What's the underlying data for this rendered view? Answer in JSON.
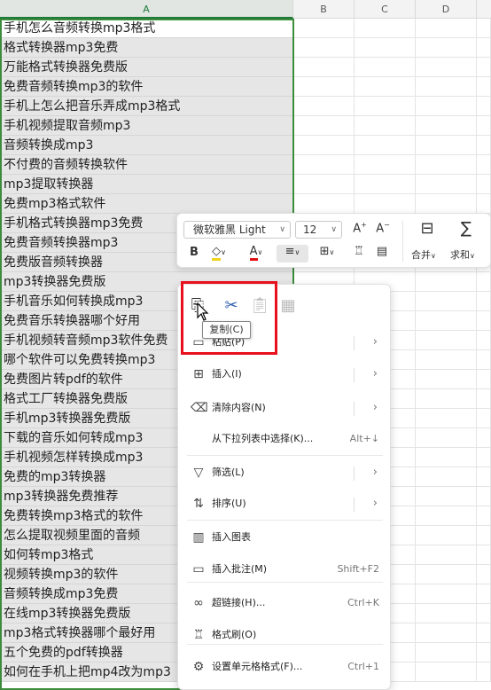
{
  "columns": [
    "A",
    "B",
    "C",
    "D"
  ],
  "rows": [
    "手机怎么音频转换mp3格式",
    "格式转换器mp3免费",
    "万能格式转换器免费版",
    "免费音频转换mp3的软件",
    "手机上怎么把音乐弄成mp3格式",
    "手机视频提取音频mp3",
    "音频转换成mp3",
    "不付费的音频转换软件",
    "mp3提取转换器",
    "免费mp3格式软件",
    "手机格式转换器mp3免费",
    "免费音频转换器mp3",
    "免费版音频转换器",
    "mp3转换器免费版",
    "手机音乐如何转换成mp3",
    "免费音乐转换器哪个好用",
    "手机视频转音频mp3软件免费",
    "哪个软件可以免费转换mp3",
    "免费图片转pdf的软件",
    "格式工厂转换器免费版",
    "手机mp3转换器免费版",
    "下载的音乐如何转成mp3",
    "手机视频怎样转换成mp3",
    "免费的mp3转换器",
    "mp3转换器免费推荐",
    "免费转换mp3格式的软件",
    "怎么提取视频里面的音频",
    "如何转mp3格式",
    "视频转换mp3的软件",
    "音频转换成mp3免费",
    "在线mp3转换器免费版",
    "mp3格式转换器哪个最好用",
    "五个免费的pdf转换器",
    "如何在手机上把mp4改为mp3"
  ],
  "toolbar": {
    "font_name": "微软雅黑 Light",
    "font_size": "12",
    "bold": "B",
    "merge_label": "合并",
    "sum_label": "求和"
  },
  "context_menu": {
    "tooltip": "复制(C)",
    "items": [
      {
        "label": "粘贴(P)",
        "icon": "paste-icon",
        "shortcut": "",
        "has_submenu": true
      },
      {
        "label": "插入(I)",
        "icon": "insert-icon",
        "shortcut": "",
        "has_submenu": true
      },
      {
        "label": "清除内容(N)",
        "icon": "clear-icon",
        "shortcut": "",
        "has_submenu": true
      },
      {
        "label": "从下拉列表中选择(K)...",
        "icon": "",
        "shortcut": "Alt+↓",
        "has_submenu": false
      },
      {
        "label": "筛选(L)",
        "icon": "filter-icon",
        "shortcut": "",
        "has_submenu": true
      },
      {
        "label": "排序(U)",
        "icon": "sort-icon",
        "shortcut": "",
        "has_submenu": true
      },
      {
        "label": "插入图表",
        "icon": "chart-icon",
        "shortcut": "",
        "has_submenu": false
      },
      {
        "label": "插入批注(M)",
        "icon": "comment-icon",
        "shortcut": "Shift+F2",
        "has_submenu": false
      },
      {
        "label": "超链接(H)...",
        "icon": "link-icon",
        "shortcut": "Ctrl+K",
        "has_submenu": false
      },
      {
        "label": "格式刷(O)",
        "icon": "format-painter-icon",
        "shortcut": "",
        "has_submenu": false
      },
      {
        "label": "设置单元格格式(F)...",
        "icon": "cell-format-icon",
        "shortcut": "Ctrl+1",
        "has_submenu": false
      }
    ]
  },
  "colors": {
    "selection_green": "#3c8c3c",
    "highlight_red": "#e8101c"
  }
}
